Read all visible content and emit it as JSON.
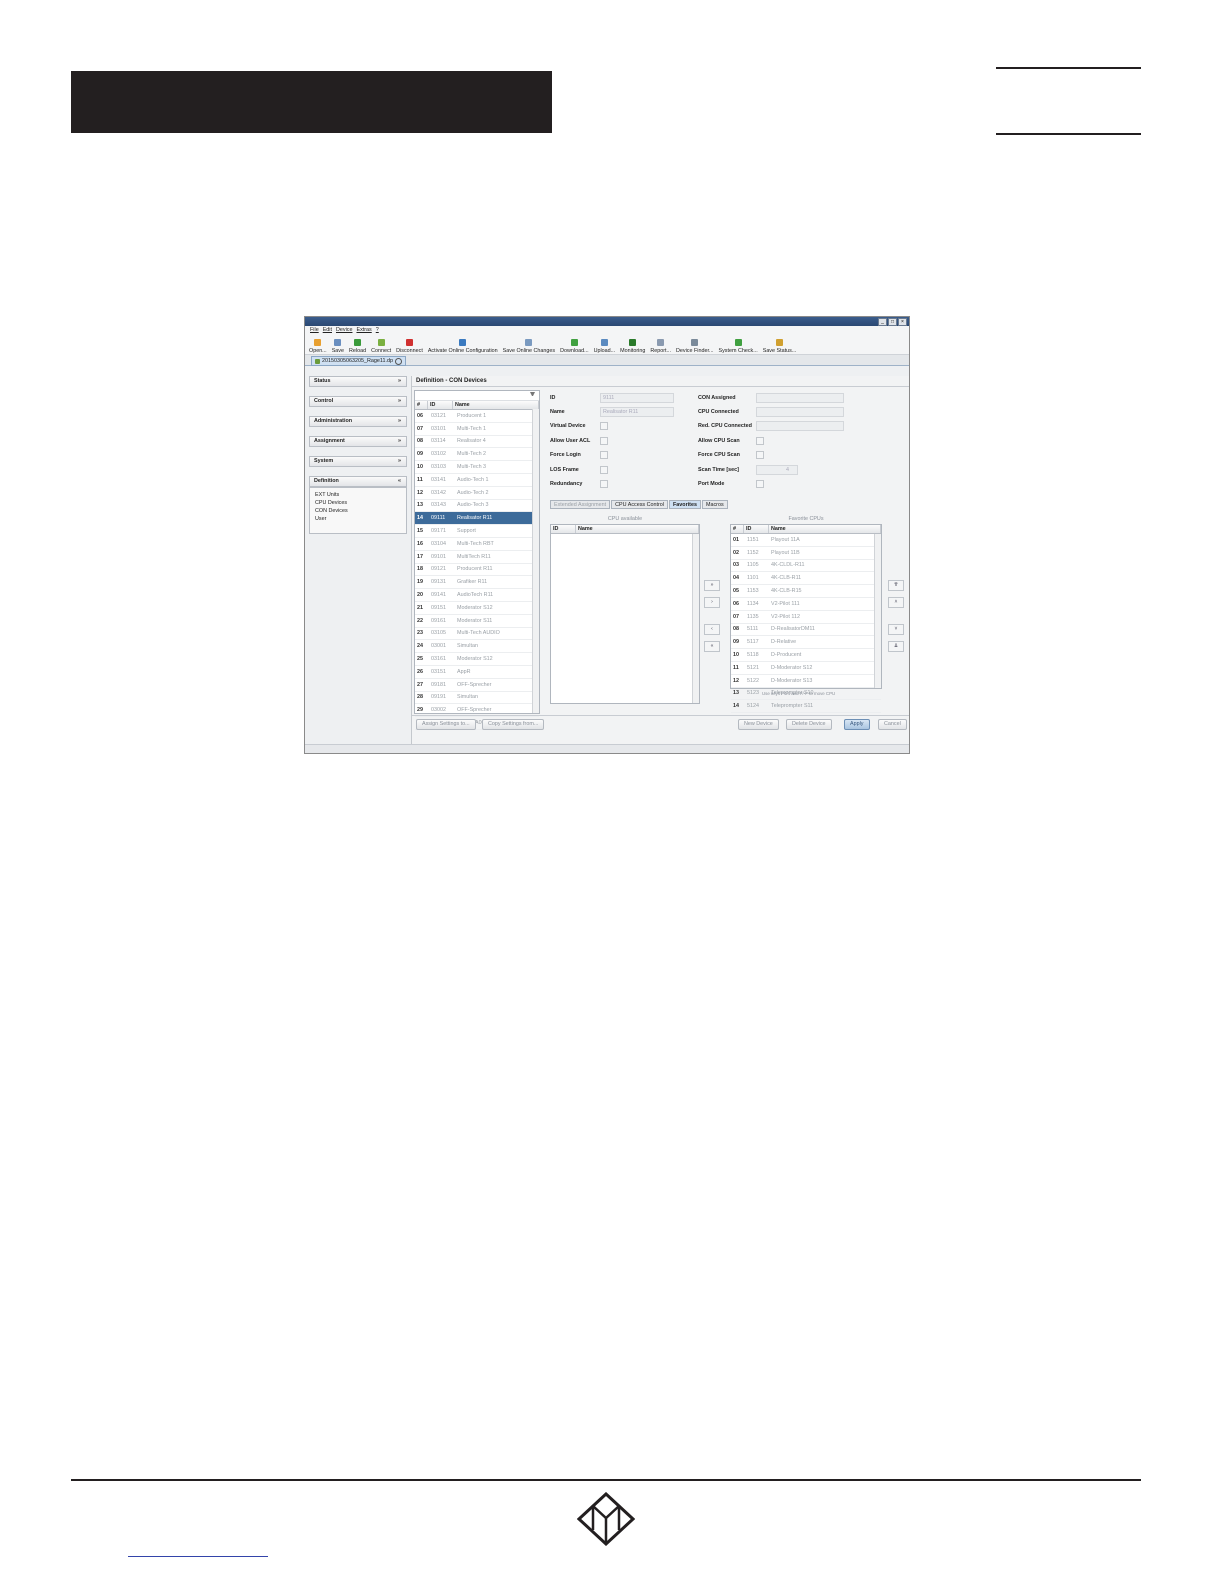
{
  "window": {
    "menu": [
      "File",
      "Edit",
      "Device",
      "Extras",
      "?"
    ],
    "toolbar": [
      {
        "label": "Open...",
        "icon": "folder-open-icon",
        "color": "#e8a030"
      },
      {
        "label": "Save",
        "icon": "save-icon",
        "color": "#6a8fc0"
      },
      {
        "label": "Reload",
        "icon": "reload-icon",
        "color": "#3a9a3a"
      },
      {
        "label": "Connect",
        "icon": "connect-icon",
        "color": "#7ab040"
      },
      {
        "label": "Disconnect",
        "icon": "disconnect-icon",
        "color": "#d03030"
      },
      {
        "label": "Activate Online Configuration",
        "icon": "activate-icon",
        "color": "#3a7ac0"
      },
      {
        "label": "Save Online Changes",
        "icon": "save-online-icon",
        "color": "#7a9ac0"
      },
      {
        "label": "Download...",
        "icon": "download-icon",
        "color": "#40a040"
      },
      {
        "label": "Upload...",
        "icon": "upload-icon",
        "color": "#5a8ac0"
      },
      {
        "label": "Monitoring",
        "icon": "monitoring-icon",
        "color": "#2a7a2a"
      },
      {
        "label": "Report...",
        "icon": "report-icon",
        "color": "#8a9ab0"
      },
      {
        "label": "Device Finder...",
        "icon": "device-finder-icon",
        "color": "#7a8a9a"
      },
      {
        "label": "System Check...",
        "icon": "system-check-icon",
        "color": "#40a040"
      },
      {
        "label": "Save Status...",
        "icon": "save-status-icon",
        "color": "#d0a030"
      }
    ],
    "file_tab": "20150305063205_Rage11.dp",
    "nav": {
      "sections": [
        {
          "label": "Status",
          "chevron": "»"
        },
        {
          "label": "Control",
          "chevron": "»"
        },
        {
          "label": "Administration",
          "chevron": "»"
        },
        {
          "label": "Assignment",
          "chevron": "»"
        },
        {
          "label": "System",
          "chevron": "»"
        },
        {
          "label": "Definition",
          "chevron": "«"
        }
      ],
      "definition_items": [
        "EXT Units",
        "CPU Devices",
        "CON Devices",
        "User"
      ]
    },
    "pane_title": "Definition - CON Devices",
    "device_list": {
      "columns": [
        "#",
        "ID",
        "Name"
      ],
      "rows": [
        {
          "n": "06",
          "id": "03121",
          "name": "Producent 1"
        },
        {
          "n": "07",
          "id": "03101",
          "name": "Multi-Tech 1"
        },
        {
          "n": "08",
          "id": "03114",
          "name": "Realisator 4"
        },
        {
          "n": "09",
          "id": "03102",
          "name": "Multi-Tech 2"
        },
        {
          "n": "10",
          "id": "03103",
          "name": "Multi-Tech 3"
        },
        {
          "n": "11",
          "id": "03141",
          "name": "Audio-Tech 1"
        },
        {
          "n": "12",
          "id": "03142",
          "name": "Audio-Tech 2"
        },
        {
          "n": "13",
          "id": "03143",
          "name": "Audio-Tech 3"
        },
        {
          "n": "14",
          "id": "09111",
          "name": "Realisator R11"
        },
        {
          "n": "15",
          "id": "09171",
          "name": "Support"
        },
        {
          "n": "16",
          "id": "03104",
          "name": "Multi-Tech RBT"
        },
        {
          "n": "17",
          "id": "09101",
          "name": "MultiTech R11"
        },
        {
          "n": "18",
          "id": "09121",
          "name": "Producent R11"
        },
        {
          "n": "19",
          "id": "09131",
          "name": "Grafiker R11"
        },
        {
          "n": "20",
          "id": "09141",
          "name": "AudioTech R11"
        },
        {
          "n": "21",
          "id": "09151",
          "name": "Moderator S12"
        },
        {
          "n": "22",
          "id": "09161",
          "name": "Moderator S11"
        },
        {
          "n": "23",
          "id": "03105",
          "name": "Multi-Tech AUDIO"
        },
        {
          "n": "24",
          "id": "03001",
          "name": "Simultan"
        },
        {
          "n": "25",
          "id": "03161",
          "name": "Moderator S12"
        },
        {
          "n": "26",
          "id": "03151",
          "name": "AppR"
        },
        {
          "n": "27",
          "id": "09181",
          "name": "OFF-Sprecher"
        },
        {
          "n": "28",
          "id": "09191",
          "name": "Simultan"
        },
        {
          "n": "29",
          "id": "03002",
          "name": "OFF-Sprecher"
        },
        {
          "n": "30",
          "id": "03003",
          "name": "CON_0A000B846"
        }
      ],
      "selected_index": 8
    },
    "props_left": [
      {
        "label": "ID",
        "value": "9111",
        "kind": "field"
      },
      {
        "label": "Name",
        "value": "Realisator R11",
        "kind": "field"
      },
      {
        "label": "Virtual Device",
        "value": "",
        "kind": "check"
      },
      {
        "label": "Allow User ACL",
        "value": "",
        "kind": "check"
      },
      {
        "label": "Force Login",
        "value": "",
        "kind": "check"
      },
      {
        "label": "LOS Frame",
        "value": "",
        "kind": "check"
      },
      {
        "label": "Redundancy",
        "value": "",
        "kind": "check"
      }
    ],
    "props_right": [
      {
        "label": "CON Assigned",
        "value": "",
        "kind": "field"
      },
      {
        "label": "CPU Connected",
        "value": "",
        "kind": "field"
      },
      {
        "label": "Red. CPU Connected",
        "value": "",
        "kind": "field"
      },
      {
        "label": "Allow CPU Scan",
        "value": "",
        "kind": "check"
      },
      {
        "label": "Force CPU Scan",
        "value": "",
        "kind": "check"
      },
      {
        "label": "Scan Time [sec]",
        "value": "4",
        "kind": "spin"
      },
      {
        "label": "Port Mode",
        "value": "",
        "kind": "check"
      }
    ],
    "subtabs": [
      {
        "label": "Extended Assignment",
        "state": "disabled"
      },
      {
        "label": "CPU Access Control",
        "state": "normal"
      },
      {
        "label": "Favorites",
        "state": "active"
      },
      {
        "label": "Macros",
        "state": "normal"
      }
    ],
    "cpu_available": {
      "title": "CPU available",
      "columns": [
        "ID",
        "Name"
      ]
    },
    "favorite_cpus": {
      "title": "Favorite CPUs",
      "columns": [
        "#",
        "ID",
        "Name"
      ],
      "rows": [
        {
          "n": "01",
          "id": "1151",
          "name": "Playout 11A"
        },
        {
          "n": "02",
          "id": "1152",
          "name": "Playout 11B"
        },
        {
          "n": "03",
          "id": "1105",
          "name": "4K-CLDL-R11"
        },
        {
          "n": "04",
          "id": "1101",
          "name": "4K-CLB-R11"
        },
        {
          "n": "05",
          "id": "1153",
          "name": "4K-CLB-R15"
        },
        {
          "n": "06",
          "id": "1134",
          "name": "V2-Pilot 111"
        },
        {
          "n": "07",
          "id": "1135",
          "name": "V2-Pilot 112"
        },
        {
          "n": "08",
          "id": "5111",
          "name": "D-RealisatorDM11"
        },
        {
          "n": "09",
          "id": "5117",
          "name": "D-Relative"
        },
        {
          "n": "10",
          "id": "5118",
          "name": "D-Producent"
        },
        {
          "n": "11",
          "id": "5121",
          "name": "D-Moderator S12"
        },
        {
          "n": "12",
          "id": "5122",
          "name": "D-Moderator S13"
        },
        {
          "n": "13",
          "id": "5123",
          "name": "Teleprompter S10"
        },
        {
          "n": "14",
          "id": "5124",
          "name": "Teleprompter S11"
        }
      ],
      "hint": "Use keys F4/4 and F/-F to move CPU"
    },
    "move_buttons": [
      "»",
      "›",
      "‹",
      "«"
    ],
    "order_buttons": [
      "⇈",
      "˄",
      "˅",
      "⇊"
    ],
    "buttons": {
      "assign_settings": "Assign Settings to...",
      "copy_settings": "Copy Settings from...",
      "new_device": "New Device",
      "delete_device": "Delete Device",
      "apply": "Apply",
      "cancel": "Cancel"
    }
  }
}
